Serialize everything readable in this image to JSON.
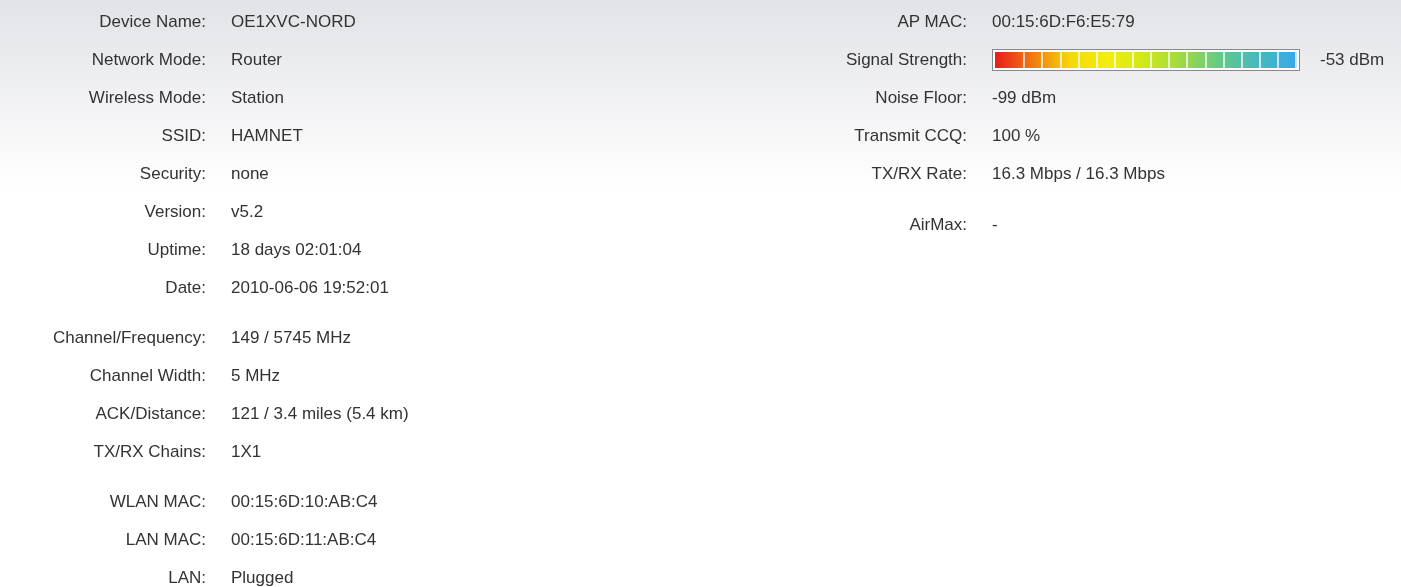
{
  "left_groups": [
    [
      {
        "label": "Device Name:",
        "value": "OE1XVC-NORD"
      },
      {
        "label": "Network Mode:",
        "value": "Router"
      },
      {
        "label": "Wireless Mode:",
        "value": "Station"
      },
      {
        "label": "SSID:",
        "value": "HAMNET"
      },
      {
        "label": "Security:",
        "value": "none"
      },
      {
        "label": "Version:",
        "value": "v5.2"
      },
      {
        "label": "Uptime:",
        "value": "18 days 02:01:04"
      },
      {
        "label": "Date:",
        "value": "2010-06-06 19:52:01"
      }
    ],
    [
      {
        "label": "Channel/Frequency:",
        "value": "149  /  5745 MHz"
      },
      {
        "label": "Channel Width:",
        "value": "5 MHz"
      },
      {
        "label": "ACK/Distance:",
        "value": "121 / 3.4 miles (5.4 km)"
      },
      {
        "label": "TX/RX Chains:",
        "value": "1X1"
      }
    ],
    [
      {
        "label": "WLAN MAC:",
        "value": "00:15:6D:10:AB:C4"
      },
      {
        "label": "LAN MAC:",
        "value": "00:15:6D:11:AB:C4"
      },
      {
        "label": "LAN:",
        "value": "Plugged"
      }
    ]
  ],
  "right_groups": [
    [
      {
        "kind": "text",
        "label": "AP MAC:",
        "value": "00:15:6D:F6:E5:79"
      },
      {
        "kind": "meter",
        "label": "Signal Strength:",
        "level": 1,
        "reading": "-53 dBm"
      },
      {
        "kind": "text",
        "label": "Noise Floor:",
        "value": "-99 dBm"
      },
      {
        "kind": "text",
        "label": "Transmit CCQ:",
        "value": "100 %"
      },
      {
        "kind": "text",
        "label": "TX/RX Rate:",
        "value": "16.3 Mbps  /  16.3 Mbps"
      }
    ],
    [
      {
        "kind": "text",
        "label": "AirMax:",
        "value": "-"
      }
    ]
  ]
}
